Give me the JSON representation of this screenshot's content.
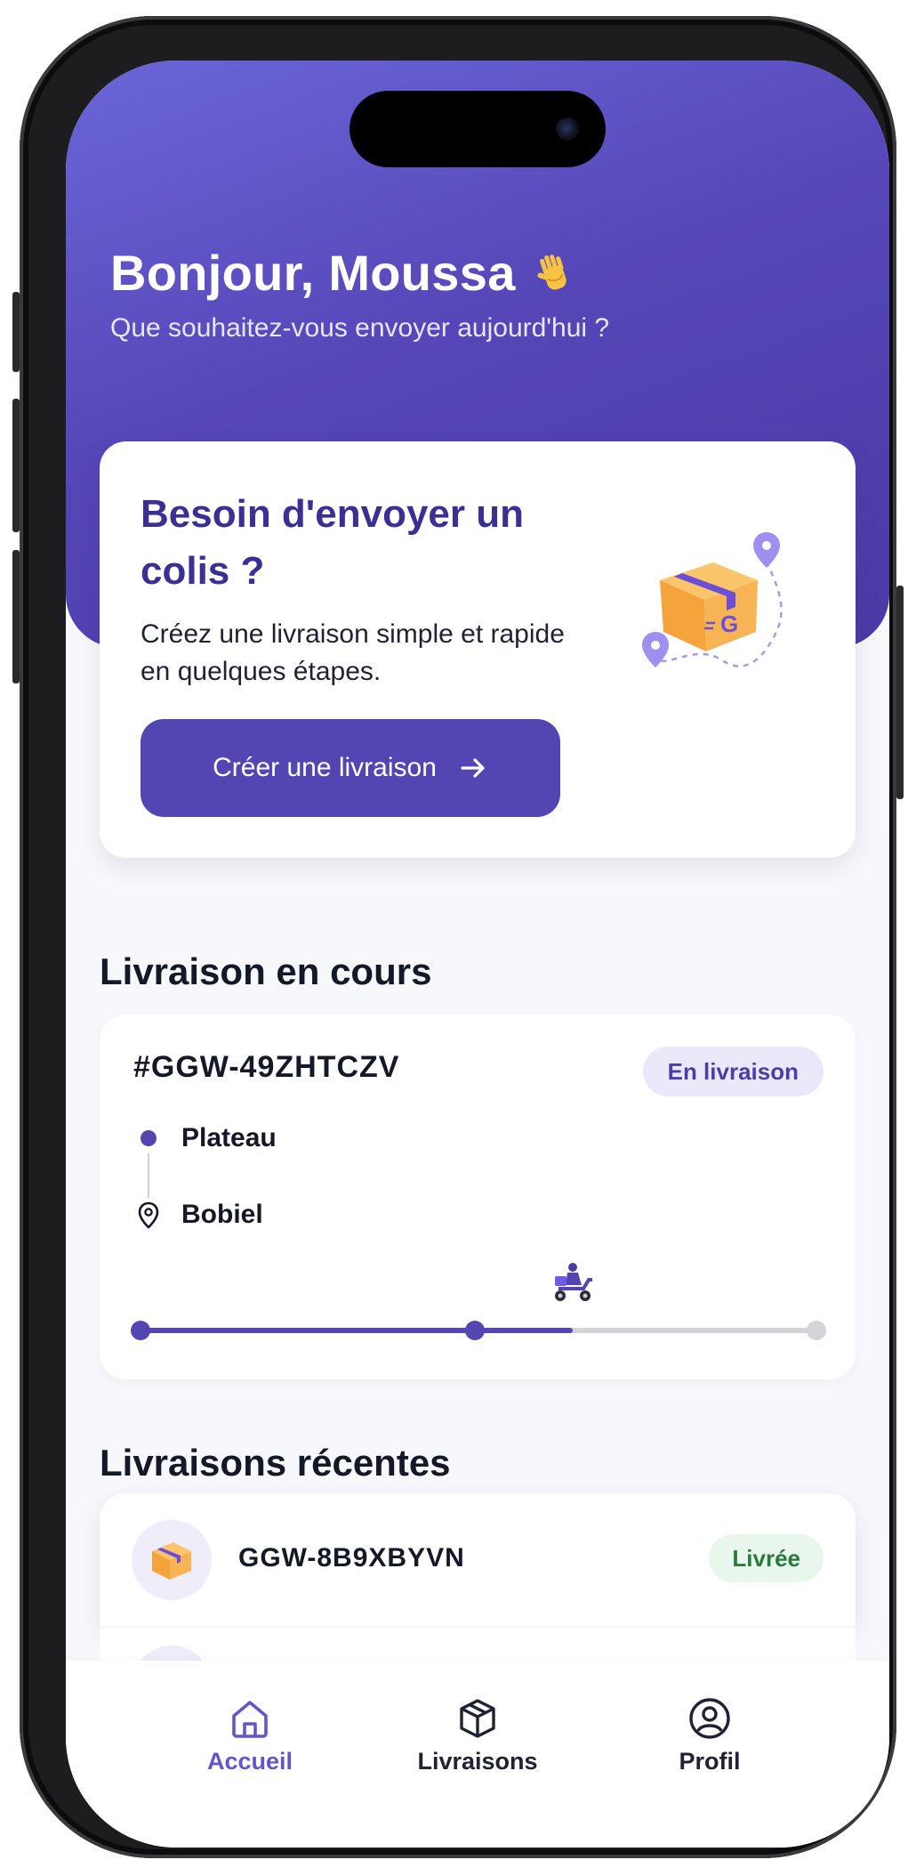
{
  "header": {
    "greeting": "Bonjour, Moussa",
    "subtitle": "Que souhaitez-vous envoyer aujourd'hui ?"
  },
  "promo": {
    "title": "Besoin d'envoyer un colis ?",
    "description": "Créez une livraison simple et rapide en quelques étapes.",
    "cta_label": "Créer une livraison"
  },
  "current": {
    "section_title": "Livraison en cours",
    "code": "#GGW-49ZHTCZV",
    "status": "En livraison",
    "origin": "Plateau",
    "destination": "Bobiel",
    "progress": 0.64
  },
  "recent": {
    "section_title": "Livraisons récentes",
    "items": [
      {
        "code": "GGW-8B9XBYVN",
        "status": "Livrée"
      }
    ]
  },
  "nav": {
    "items": [
      {
        "label": "Accueil",
        "icon": "home-icon",
        "active": true
      },
      {
        "label": "Livraisons",
        "icon": "package-icon",
        "active": false
      },
      {
        "label": "Profil",
        "icon": "profile-icon",
        "active": false
      }
    ]
  },
  "colors": {
    "primary": "#5446b2",
    "hero_gradient_start": "#6b66d9",
    "hero_gradient_end": "#4a3aa5",
    "success_text": "#2a7a3f",
    "track_inactive": "#d4d4d8"
  }
}
